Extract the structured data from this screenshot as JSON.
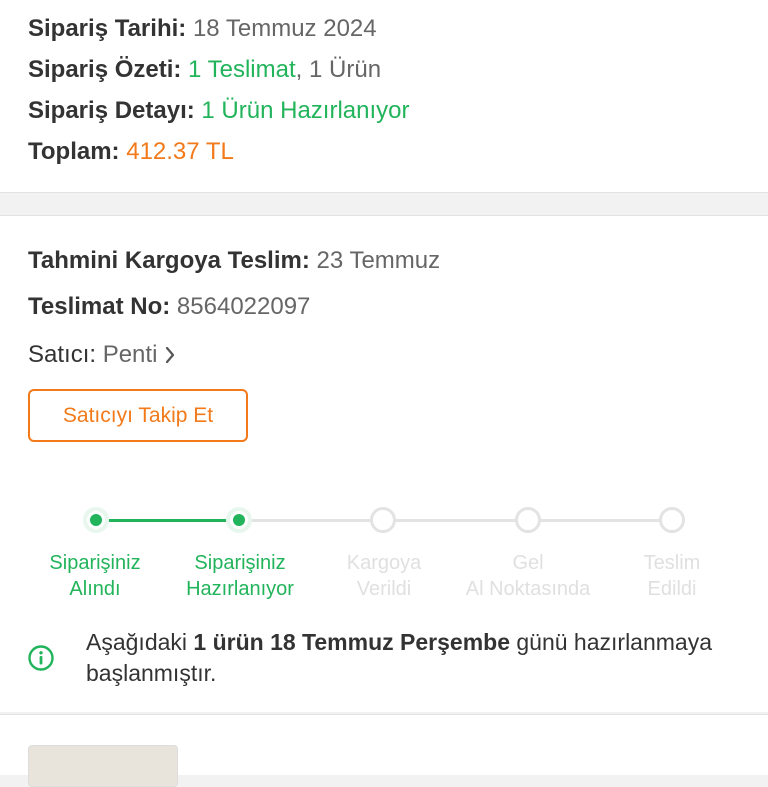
{
  "order": {
    "date_label": "Sipariş Tarihi:",
    "date_value": "18 Temmuz 2024",
    "summary_label": "Sipariş Özeti:",
    "summary_deliveries": "1 Teslimat",
    "summary_sep": ",",
    "summary_items": "1 Ürün",
    "detail_label": "Sipariş Detayı:",
    "detail_value": "1 Ürün Hazırlanıyor",
    "total_label": "Toplam:",
    "total_value": "412.37 TL"
  },
  "delivery": {
    "estimate_label": "Tahmini Kargoya Teslim:",
    "estimate_value": "23 Temmuz",
    "number_label": "Teslimat No:",
    "number_value": "8564022097",
    "seller_label": "Satıcı:",
    "seller_value": "Penti",
    "follow_button": "Satıcıyı Takip Et"
  },
  "tracker": {
    "steps": [
      {
        "line1": "Siparişiniz",
        "line2": "Alındı",
        "done": true
      },
      {
        "line1": "Siparişiniz",
        "line2": "Hazırlanıyor",
        "done": true
      },
      {
        "line1": "Kargoya",
        "line2": "Verildi",
        "done": false
      },
      {
        "line1": "Gel",
        "line2": "Al Noktasında",
        "done": false
      },
      {
        "line1": "Teslim",
        "line2": "Edildi",
        "done": false
      }
    ],
    "info_pre": "Aşağıdaki ",
    "info_count": "1 ürün",
    "info_mid": " ",
    "info_date": "18 Temmuz Perşembe",
    "info_post": " günü hazırlanmaya başlanmıştır."
  },
  "colors": {
    "green": "#22b45b",
    "orange": "#f27a1a"
  },
  "icons": {
    "seller_chevron": "chevron-right-icon",
    "info": "info-icon"
  }
}
